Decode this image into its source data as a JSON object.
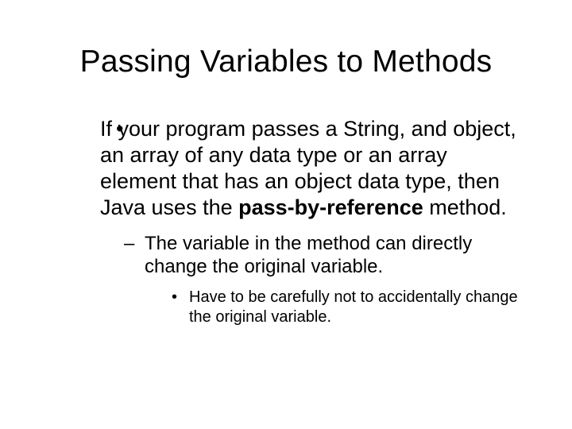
{
  "title": "Passing Variables to Methods",
  "bullet1_pre": "If your program passes a String, and object, an array of any data type or an array element that has an object data type, then Java uses the ",
  "bullet1_bold": "pass-by-reference",
  "bullet1_post": " method.",
  "bullet2": "The variable in the method can directly change the original variable.",
  "bullet3": "Have to be carefully not to accidentally change the original variable."
}
